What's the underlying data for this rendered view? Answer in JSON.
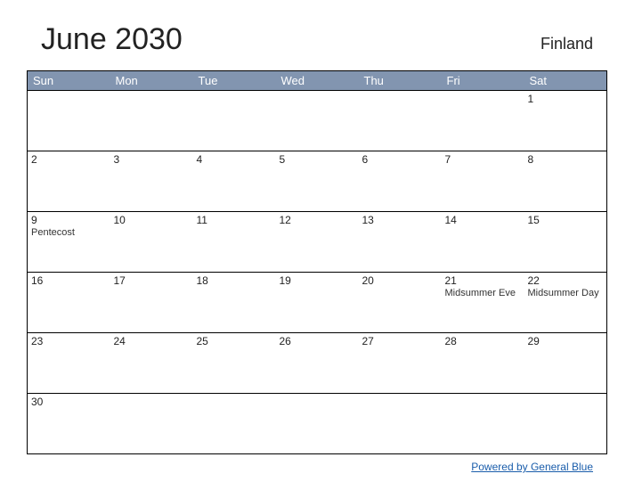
{
  "header": {
    "title": "June 2030",
    "region": "Finland"
  },
  "weekdays": [
    "Sun",
    "Mon",
    "Tue",
    "Wed",
    "Thu",
    "Fri",
    "Sat"
  ],
  "weeks": [
    [
      {
        "day": "",
        "event": ""
      },
      {
        "day": "",
        "event": ""
      },
      {
        "day": "",
        "event": ""
      },
      {
        "day": "",
        "event": ""
      },
      {
        "day": "",
        "event": ""
      },
      {
        "day": "",
        "event": ""
      },
      {
        "day": "1",
        "event": ""
      }
    ],
    [
      {
        "day": "2",
        "event": ""
      },
      {
        "day": "3",
        "event": ""
      },
      {
        "day": "4",
        "event": ""
      },
      {
        "day": "5",
        "event": ""
      },
      {
        "day": "6",
        "event": ""
      },
      {
        "day": "7",
        "event": ""
      },
      {
        "day": "8",
        "event": ""
      }
    ],
    [
      {
        "day": "9",
        "event": "Pentecost"
      },
      {
        "day": "10",
        "event": ""
      },
      {
        "day": "11",
        "event": ""
      },
      {
        "day": "12",
        "event": ""
      },
      {
        "day": "13",
        "event": ""
      },
      {
        "day": "14",
        "event": ""
      },
      {
        "day": "15",
        "event": ""
      }
    ],
    [
      {
        "day": "16",
        "event": ""
      },
      {
        "day": "17",
        "event": ""
      },
      {
        "day": "18",
        "event": ""
      },
      {
        "day": "19",
        "event": ""
      },
      {
        "day": "20",
        "event": ""
      },
      {
        "day": "21",
        "event": "Midsummer Eve"
      },
      {
        "day": "22",
        "event": "Midsummer Day"
      }
    ],
    [
      {
        "day": "23",
        "event": ""
      },
      {
        "day": "24",
        "event": ""
      },
      {
        "day": "25",
        "event": ""
      },
      {
        "day": "26",
        "event": ""
      },
      {
        "day": "27",
        "event": ""
      },
      {
        "day": "28",
        "event": ""
      },
      {
        "day": "29",
        "event": ""
      }
    ],
    [
      {
        "day": "30",
        "event": ""
      },
      {
        "day": "",
        "event": ""
      },
      {
        "day": "",
        "event": ""
      },
      {
        "day": "",
        "event": ""
      },
      {
        "day": "",
        "event": ""
      },
      {
        "day": "",
        "event": ""
      },
      {
        "day": "",
        "event": ""
      }
    ]
  ],
  "footer": {
    "link_text": "Powered by General Blue"
  }
}
